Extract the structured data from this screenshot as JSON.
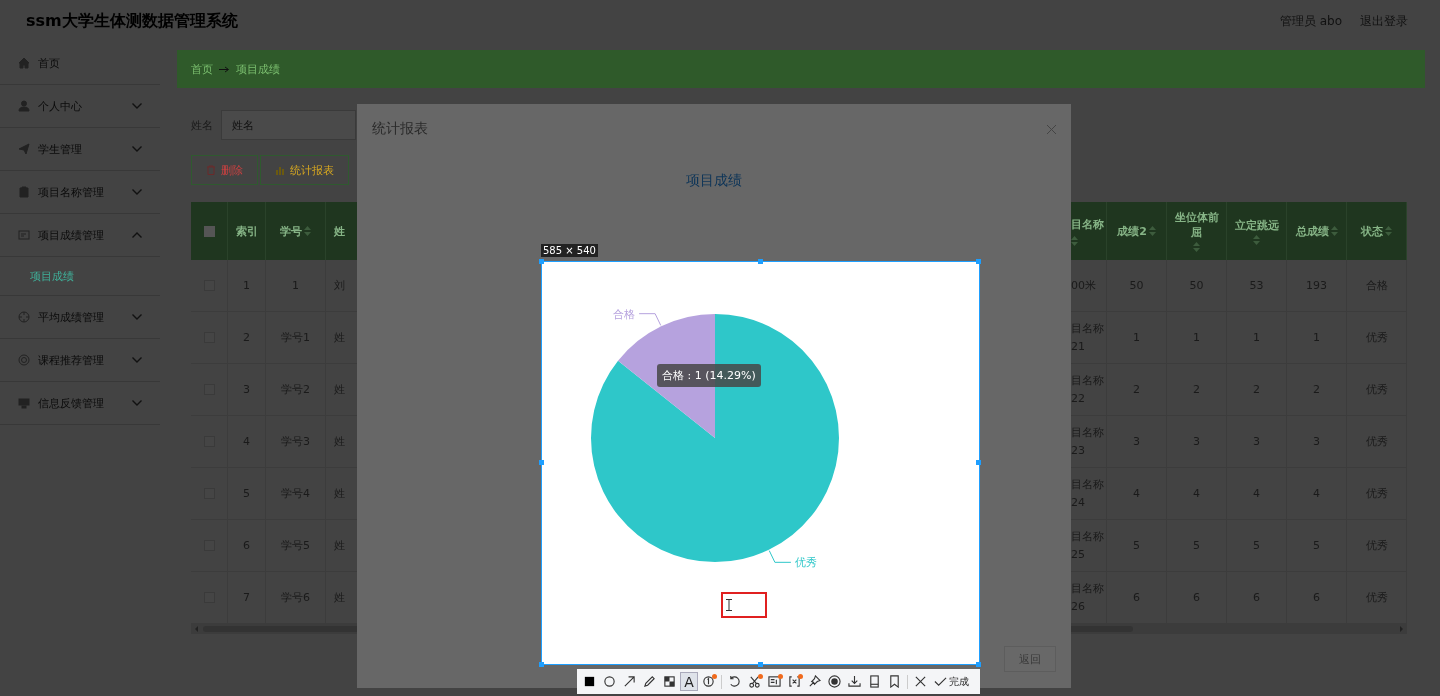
{
  "header": {
    "title": "ssm大学生体测数据管理系统",
    "user": "管理员 abo",
    "logout": "退出登录"
  },
  "sidebar": {
    "items": [
      {
        "kind": "link",
        "label": "首页"
      },
      {
        "kind": "menu",
        "label": "个人中心",
        "expanded": false
      },
      {
        "kind": "menu",
        "label": "学生管理",
        "expanded": false
      },
      {
        "kind": "menu",
        "label": "项目名称管理",
        "expanded": false
      },
      {
        "kind": "menu",
        "label": "项目成绩管理",
        "expanded": true,
        "children": [
          {
            "label": "项目成绩",
            "selected": true
          }
        ]
      },
      {
        "kind": "menu",
        "label": "平均成绩管理",
        "expanded": false
      },
      {
        "kind": "menu",
        "label": "课程推荐管理",
        "expanded": false
      },
      {
        "kind": "menu",
        "label": "信息反馈管理",
        "expanded": false
      }
    ]
  },
  "breadcrumb": [
    "首页",
    "项目成绩"
  ],
  "search": {
    "label": "姓名",
    "placeholder": "姓名"
  },
  "actions": [
    {
      "kind": "delete",
      "label": "删除"
    },
    {
      "kind": "report",
      "label": "统计报表"
    }
  ],
  "table": {
    "select_all": {
      "checked": false
    },
    "columns": [
      {
        "label": "索引",
        "sortable": false
      },
      {
        "label": "学号",
        "sortable": true
      },
      {
        "label": "姓",
        "sortable": false
      },
      {
        "label": "目名称",
        "sortable": true
      },
      {
        "label": "成绩2",
        "sortable": true
      },
      {
        "label": "坐位体前屈",
        "sortable": true
      },
      {
        "label": "立定跳远",
        "sortable": true
      },
      {
        "label": "总成绩",
        "sortable": true
      },
      {
        "label": "状态",
        "sortable": true
      }
    ],
    "rows": [
      {
        "checked": false,
        "cells": [
          "1",
          "1",
          "刘",
          "00米",
          "50",
          "50",
          "53",
          "193",
          "合格"
        ]
      },
      {
        "checked": false,
        "cells": [
          "2",
          "学号1",
          "姓",
          "目名称21",
          "1",
          "1",
          "1",
          "1",
          "优秀"
        ]
      },
      {
        "checked": false,
        "cells": [
          "3",
          "学号2",
          "姓",
          "目名称22",
          "2",
          "2",
          "2",
          "2",
          "优秀"
        ]
      },
      {
        "checked": false,
        "cells": [
          "4",
          "学号3",
          "姓",
          "目名称23",
          "3",
          "3",
          "3",
          "3",
          "优秀"
        ]
      },
      {
        "checked": false,
        "cells": [
          "5",
          "学号4",
          "姓",
          "目名称24",
          "4",
          "4",
          "4",
          "4",
          "优秀"
        ]
      },
      {
        "checked": false,
        "cells": [
          "6",
          "学号5",
          "姓",
          "目名称25",
          "5",
          "5",
          "5",
          "5",
          "优秀"
        ]
      },
      {
        "checked": false,
        "cells": [
          "7",
          "学号6",
          "姓",
          "目名称26",
          "6",
          "6",
          "6",
          "6",
          "优秀"
        ]
      }
    ]
  },
  "modal": {
    "title": "统计报表",
    "chart_data": {
      "type": "pie",
      "title": "项目成绩",
      "categories": [
        "优秀",
        "合格"
      ],
      "values": [
        85.71,
        14.29
      ]
    },
    "tooltip": "合格 : 1 (14.29%)",
    "footer_button": "返回"
  },
  "screenshot_tool": {
    "size_label": "585 × 540",
    "tool_groups": [
      [
        {
          "kind": "rect",
          "selected": false,
          "dot": false
        },
        {
          "kind": "circle",
          "selected": false,
          "dot": false
        },
        {
          "kind": "arrow",
          "selected": false,
          "dot": false
        },
        {
          "kind": "pencil",
          "selected": false,
          "dot": false
        },
        {
          "kind": "mosaic",
          "selected": false,
          "dot": false
        },
        {
          "kind": "text",
          "label": "A",
          "selected": true,
          "dot": false
        },
        {
          "kind": "counter",
          "selected": false,
          "dot": true
        }
      ],
      [
        {
          "kind": "undo",
          "selected": false,
          "dot": false
        },
        {
          "kind": "cut",
          "selected": false,
          "dot": true
        },
        {
          "kind": "ocr",
          "selected": false,
          "dot": true
        },
        {
          "kind": "expand",
          "selected": false,
          "dot": true
        },
        {
          "kind": "pin",
          "selected": false,
          "dot": false
        },
        {
          "kind": "record",
          "selected": false,
          "dot": false
        },
        {
          "kind": "download",
          "selected": false,
          "dot": false
        },
        {
          "kind": "phone",
          "selected": false,
          "dot": false
        },
        {
          "kind": "bookmark",
          "selected": false,
          "dot": false
        }
      ],
      [
        {
          "kind": "close",
          "selected": false,
          "dot": false
        },
        {
          "kind": "done",
          "label": "完成",
          "selected": false,
          "dot": false
        }
      ]
    ]
  }
}
